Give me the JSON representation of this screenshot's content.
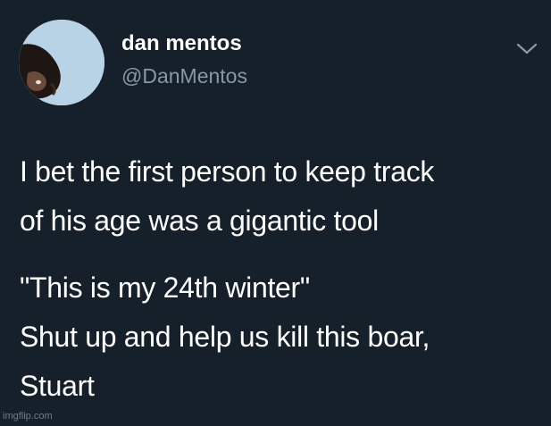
{
  "tweet": {
    "display_name": "dan mentos",
    "handle": "@DanMentos",
    "lines": [
      "I bet the first person to keep track",
      "of his age was a gigantic tool",
      "\"This is my 24th winter\"",
      "Shut up and help us kill this boar,",
      "Stuart"
    ]
  },
  "icons": {
    "menu": "chevron-down-icon",
    "avatar": "profile-photo"
  },
  "watermark": "imgflip.com",
  "colors": {
    "background": "#15202b",
    "text": "#ffffff",
    "secondary": "#8899a6"
  }
}
